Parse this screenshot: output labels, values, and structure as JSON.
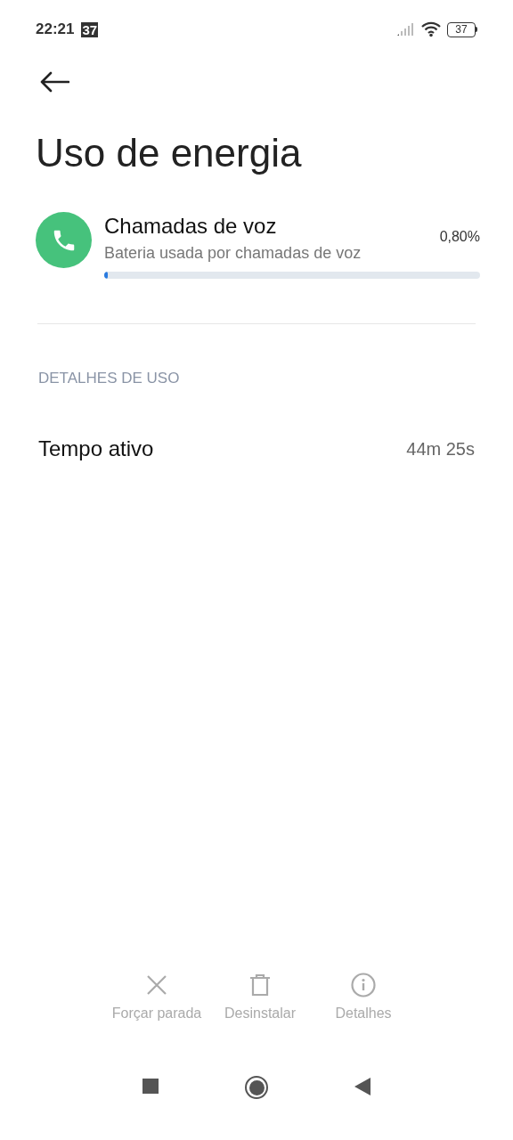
{
  "status_bar": {
    "time": "22:21",
    "notification_badge": "37",
    "battery": "37"
  },
  "title": "Uso de energia",
  "app": {
    "name": "Chamadas de voz",
    "subtitle": "Bateria usada por chamadas de voz",
    "percent": "0,80%",
    "level": 0.008
  },
  "section_header": "DETALHES DE USO",
  "details": [
    {
      "label": "Tempo ativo",
      "value": "44m 25s"
    }
  ],
  "actions": [
    {
      "kind": "close",
      "label": "Forçar parada"
    },
    {
      "kind": "trash",
      "label": "Desinstalar"
    },
    {
      "kind": "info",
      "label": "Detalhes"
    }
  ]
}
